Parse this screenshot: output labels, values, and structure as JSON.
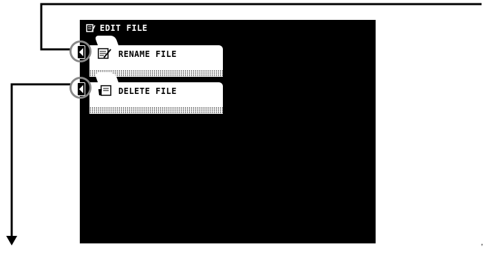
{
  "screen": {
    "title": "EDIT FILE",
    "title_icon": "edit-file-icon",
    "items": [
      {
        "label": "RENAME FILE",
        "icon": "rename-file-icon"
      },
      {
        "label": "DELETE FILE",
        "icon": "delete-file-icon"
      }
    ]
  },
  "colors": {
    "lcd": "#000000",
    "panel": "#ffffff",
    "highlight_ring": "#888888"
  }
}
